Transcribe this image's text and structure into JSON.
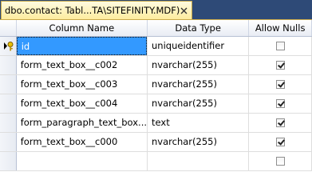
{
  "tab": {
    "title": "dbo.contact: Tabl...TA\\SITEFINITY.MDF)",
    "close_icon": "close-icon"
  },
  "columns": {
    "name": "Column Name",
    "type": "Data Type",
    "nulls": "Allow Nulls"
  },
  "rows": [
    {
      "name": "id",
      "type": "uniqueidentifier",
      "allow_nulls": false,
      "primary_key": true,
      "selected": true
    },
    {
      "name": "form_text_box__c002",
      "type": "nvarchar(255)",
      "allow_nulls": true
    },
    {
      "name": "form_text_box__c003",
      "type": "nvarchar(255)",
      "allow_nulls": true
    },
    {
      "name": "form_text_box__c004",
      "type": "nvarchar(255)",
      "allow_nulls": true
    },
    {
      "name": "form_paragraph_text_box...",
      "type": "text",
      "allow_nulls": true
    },
    {
      "name": "form_text_box__c000",
      "type": "nvarchar(255)",
      "allow_nulls": true
    },
    {
      "name": "",
      "type": "",
      "allow_nulls": false
    }
  ],
  "colors": {
    "tab_bg": "#fdec9e",
    "header_bar": "#2e4a77",
    "selection": "#3399ff"
  }
}
